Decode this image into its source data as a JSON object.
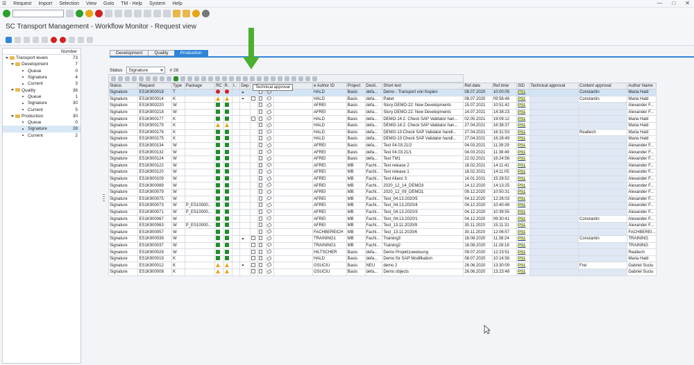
{
  "menu": [
    "Request",
    "Import",
    "Selection",
    "View",
    "Goto",
    "TM - Help",
    "System",
    "Help"
  ],
  "window_title": "SC Transport Management - Workflow Monitor - Request view",
  "tree": {
    "header_number": "Number",
    "rows": [
      {
        "label": "Transport levels",
        "num": "73",
        "level": 0,
        "type": "folder"
      },
      {
        "label": "Development",
        "num": "7",
        "level": 1,
        "type": "folder"
      },
      {
        "label": "Queue",
        "num": "0",
        "level": 2,
        "type": "item"
      },
      {
        "label": "Signature",
        "num": "4",
        "level": 2,
        "type": "item"
      },
      {
        "label": "Current",
        "num": "3",
        "level": 2,
        "type": "item"
      },
      {
        "label": "Quality",
        "num": "36",
        "level": 1,
        "type": "folder"
      },
      {
        "label": "Queue",
        "num": "1",
        "level": 2,
        "type": "item"
      },
      {
        "label": "Signature",
        "num": "30",
        "level": 2,
        "type": "item"
      },
      {
        "label": "Current",
        "num": "5",
        "level": 2,
        "type": "item"
      },
      {
        "label": "Production",
        "num": "30",
        "level": 1,
        "type": "folder"
      },
      {
        "label": "Queue",
        "num": "0",
        "level": 2,
        "type": "item"
      },
      {
        "label": "Signature",
        "num": "28",
        "level": 2,
        "type": "item",
        "selected": true
      },
      {
        "label": "Current",
        "num": "2",
        "level": 2,
        "type": "item"
      }
    ]
  },
  "tabs": [
    "Development",
    "Quality",
    "Production"
  ],
  "active_tab": "Production",
  "status": {
    "label": "Status",
    "value": "Signature",
    "count": "# 28"
  },
  "tooltip": "Technical approval",
  "columns": [
    "Status",
    "Request",
    "Type",
    "Package",
    "RC",
    "R..",
    "I..",
    "Dep",
    "",
    "",
    "",
    "",
    "e Author ID",
    "Project",
    "Desti..",
    "Short text",
    "Ref.date",
    "Ref.time",
    "SID",
    "Technical approval",
    "Content approval",
    "Author Name"
  ],
  "rows": [
    {
      "status": "Signature",
      "request": "ES1K900018",
      "type": "T",
      "pkg": "",
      "rc": "red",
      "dep": "lnk",
      "chk": false,
      "author": "HALD",
      "project": "Basis",
      "dest": "defa...",
      "text": "Demo - Transport von Kopien",
      "date": "08.07.2020",
      "time": "10:00:05",
      "sid": "PS1",
      "tech": "",
      "content": "Constantin",
      "name": "Maria Hald",
      "sel": true
    },
    {
      "status": "Signature",
      "request": "ES1K900014",
      "type": "K",
      "pkg": "",
      "rc": "tri",
      "dep": "lnk",
      "chk": true,
      "author": "HALD",
      "project": "Basis",
      "dest": "defa...",
      "text": "Paket",
      "date": "08.07.2020",
      "time": "09:56:46",
      "sid": "PS1",
      "tech": "",
      "content": "Constantin",
      "name": "Maria Hald"
    },
    {
      "status": "Signature",
      "request": "ES1K900220",
      "type": "W",
      "pkg": "",
      "rc": "green",
      "dep": "",
      "chk": false,
      "author": "AFREI",
      "project": "Basis",
      "dest": "defa...",
      "text": "Story DEMO-22: New Developments",
      "date": "15.07.2021",
      "time": "10:51:42",
      "sid": "PS1",
      "tech": "",
      "content": "",
      "name": "Alexander F..."
    },
    {
      "status": "Signature",
      "request": "ES1K900218",
      "type": "W",
      "pkg": "",
      "rc": "green",
      "dep": "",
      "chk": false,
      "author": "AFREI",
      "project": "Basis",
      "dest": "defa...",
      "text": "Story DEMO-22: New Developments",
      "date": "14.07.2021",
      "time": "14:38:23",
      "sid": "PS1",
      "tech": "",
      "content": "",
      "name": "Alexander F..."
    },
    {
      "status": "Signature",
      "request": "ES1K900177",
      "type": "K",
      "pkg": "",
      "rc": "green",
      "dep": "",
      "chk": true,
      "author": "HALD",
      "project": "Basis",
      "dest": "defa...",
      "text": "DEMO-14:2. Check SAP Validator han...",
      "date": "02.05.2021",
      "time": "19:09:12",
      "sid": "PS1",
      "tech": "",
      "content": "",
      "name": "Maria Hald"
    },
    {
      "status": "Signature",
      "request": "ES1K900179",
      "type": "K",
      "pkg": "",
      "rc": "tri",
      "dep": "",
      "chk": false,
      "author": "HALD",
      "project": "Basis",
      "dest": "defa...",
      "text": "DEMO-14:2. Check SAP Validator han...",
      "date": "27.04.2021",
      "time": "16:38:37",
      "sid": "PS1",
      "tech": "",
      "content": "",
      "name": "Maria Hald"
    },
    {
      "status": "Signature",
      "request": "ES1K900176",
      "type": "K",
      "pkg": "",
      "rc": "green",
      "dep": "",
      "chk": false,
      "author": "HALD",
      "project": "Basis",
      "dest": "defa...",
      "text": "DEMO-13:Check SAP Validator handl...",
      "date": "27.04.2021",
      "time": "16:31:53",
      "sid": "PS1",
      "tech": "",
      "content": "Realtech",
      "name": "Maria Hald"
    },
    {
      "status": "Signature",
      "request": "ES1K900175",
      "type": "K",
      "pkg": "",
      "rc": "green",
      "dep": "",
      "chk": false,
      "author": "HALD",
      "project": "Basis",
      "dest": "defa...",
      "text": "DEMO-13:Check SAP Validator handl...",
      "date": "27.04.2021",
      "time": "16:28:49",
      "sid": "PS1",
      "tech": "",
      "content": "",
      "name": "Maria Hald"
    },
    {
      "status": "Signature",
      "request": "ES1K900134",
      "type": "W",
      "pkg": "",
      "rc": "green",
      "dep": "",
      "chk": false,
      "author": "AFREI",
      "project": "Basis",
      "dest": "defa...",
      "text": "Test 04.03.21/2",
      "date": "04.03.2021",
      "time": "11:39:29",
      "sid": "PS1",
      "tech": "",
      "content": "",
      "name": "Alexander F..."
    },
    {
      "status": "Signature",
      "request": "ES1K900132",
      "type": "W",
      "pkg": "",
      "rc": "green",
      "dep": "",
      "chk": false,
      "author": "AFREI",
      "project": "Basis",
      "dest": "defa...",
      "text": "Test 04.03.21/1",
      "date": "04.03.2021",
      "time": "11:38:49",
      "sid": "PS1",
      "tech": "",
      "content": "",
      "name": "Alexander F..."
    },
    {
      "status": "Signature",
      "request": "ES1K900124",
      "type": "W",
      "pkg": "",
      "rc": "green",
      "dep": "",
      "chk": false,
      "author": "AFREI",
      "project": "Basis",
      "dest": "defa...",
      "text": "Test TM1",
      "date": "22.02.2021",
      "time": "16:24:56",
      "sid": "PS1",
      "tech": "",
      "content": "",
      "name": "Alexander F..."
    },
    {
      "status": "Signature",
      "request": "ES1K900122",
      "type": "W",
      "pkg": "",
      "rc": "green",
      "dep": "",
      "chk": false,
      "author": "AFREI",
      "project": "MB",
      "dest": "Fachl...",
      "text": "Test release 2",
      "date": "18.02.2021",
      "time": "14:11:41",
      "sid": "PS1",
      "tech": "",
      "content": "",
      "name": "Alexander F..."
    },
    {
      "status": "Signature",
      "request": "ES1K900120",
      "type": "W",
      "pkg": "",
      "rc": "green",
      "dep": "",
      "chk": false,
      "author": "AFREI",
      "project": "MB",
      "dest": "Fachl...",
      "text": "Test release 1",
      "date": "18.02.2021",
      "time": "14:11:05",
      "sid": "PS1",
      "tech": "",
      "content": "",
      "name": "Alexander F..."
    },
    {
      "status": "Signature",
      "request": "ES1K900109",
      "type": "W",
      "pkg": "",
      "rc": "green",
      "dep": "",
      "chk": false,
      "author": "AFREI",
      "project": "MB",
      "dest": "Fachl...",
      "text": "Test Allanz 3",
      "date": "14.01.2021",
      "time": "15:28:52",
      "sid": "PS1",
      "tech": "",
      "content": "",
      "name": "Alexander F..."
    },
    {
      "status": "Signature",
      "request": "ES1K900089",
      "type": "W",
      "pkg": "",
      "rc": "green",
      "dep": "",
      "chk": false,
      "author": "AFREI",
      "project": "MB",
      "dest": "Fachl...",
      "text": "2020_12_14_DEMO3",
      "date": "14.12.2020",
      "time": "14:13:25",
      "sid": "PS1",
      "tech": "",
      "content": "",
      "name": "Alexander F..."
    },
    {
      "status": "Signature",
      "request": "ES1K900079",
      "type": "W",
      "pkg": "",
      "rc": "green",
      "dep": "",
      "chk": false,
      "author": "AFREI",
      "project": "MB",
      "dest": "Fachl...",
      "text": "2020_12_09_DEMO1",
      "date": "09.12.2020",
      "time": "10:50:31",
      "sid": "PS1",
      "tech": "",
      "content": "",
      "name": "Alexander F..."
    },
    {
      "status": "Signature",
      "request": "ES1K900075",
      "type": "W",
      "pkg": "",
      "rc": "green",
      "dep": "",
      "chk": false,
      "author": "AFREI",
      "project": "MB",
      "dest": "Fachl...",
      "text": "Test_04.13.2020/5",
      "date": "04.12.2020",
      "time": "12:26:03",
      "sid": "PS1",
      "tech": "",
      "content": "",
      "name": "Alexander F..."
    },
    {
      "status": "Signature",
      "request": "ES1K900073",
      "type": "W",
      "pkg": "P_ES10000...",
      "rc": "green",
      "dep": "",
      "chk": false,
      "author": "AFREI",
      "project": "MB",
      "dest": "Fachl...",
      "text": "Test_04.13.2020/4",
      "date": "04.12.2020",
      "time": "10:40:48",
      "sid": "PS1",
      "tech": "",
      "content": "",
      "name": "Alexander F..."
    },
    {
      "status": "Signature",
      "request": "ES1K900071",
      "type": "W",
      "pkg": "P_ES10000...",
      "rc": "green",
      "dep": "",
      "chk": false,
      "author": "AFREI",
      "project": "MB",
      "dest": "Fachl...",
      "text": "Test_04.13.2020/3",
      "date": "04.12.2020",
      "time": "10:39:55",
      "sid": "PS1",
      "tech": "",
      "content": "",
      "name": "Alexander F..."
    },
    {
      "status": "Signature",
      "request": "ES1K900067",
      "type": "W",
      "pkg": "",
      "rc": "green",
      "dep": "",
      "chk": false,
      "author": "AFREI",
      "project": "MB",
      "dest": "Fachl...",
      "text": "Test_04.13.2020/1",
      "date": "04.12.2020",
      "time": "09:30:41",
      "sid": "PS1",
      "tech": "",
      "content": "Constantin",
      "name": "Alexander F..."
    },
    {
      "status": "Signature",
      "request": "ES1K900063",
      "type": "W",
      "pkg": "P_ES10000...",
      "rc": "green",
      "dep": "",
      "chk": false,
      "author": "AFREI",
      "project": "MB",
      "dest": "Fachl...",
      "text": "Test_13.11.2020/9",
      "date": "30.11.2020",
      "time": "15:11:31",
      "sid": "PS1",
      "tech": "",
      "content": "",
      "name": "Alexander F..."
    },
    {
      "status": "Signature",
      "request": "ES1K900057",
      "type": "W",
      "pkg": "",
      "rc": "green",
      "dep": "",
      "chk": false,
      "author": "FACHBEREICH",
      "project": "MB",
      "dest": "Fachl...",
      "text": "Test_13.11.2020/6",
      "date": "30.11.2020",
      "time": "12:06:57",
      "sid": "PS1",
      "tech": "",
      "content": "",
      "name": "FACHBEREI..."
    },
    {
      "status": "Signature",
      "request": "ES1K900039",
      "type": "W",
      "pkg": "",
      "rc": "green",
      "dep": "lnk",
      "chk": true,
      "author": "TRAINING1",
      "project": "MB",
      "dest": "Fachl...",
      "text": "Training3",
      "date": "18.08.2020",
      "time": "11:38:24",
      "sid": "PS1",
      "tech": "",
      "content": "Constantin",
      "name": "TRAINING"
    },
    {
      "status": "Signature",
      "request": "ES1K900037",
      "type": "W",
      "pkg": "",
      "rc": "green",
      "dep": "",
      "chk": true,
      "author": "TRAINING1",
      "project": "MB",
      "dest": "Fachl...",
      "text": "Training2",
      "date": "18.08.2020",
      "time": "11:28:18",
      "sid": "PS1",
      "tech": "",
      "content": "",
      "name": "TRAINING"
    },
    {
      "status": "Signature",
      "request": "ES1K900029",
      "type": "W",
      "pkg": "",
      "rc": "green",
      "dep": "",
      "chk": true,
      "author": "HILTSCHER",
      "project": "Basis",
      "dest": "defa...",
      "text": "Demo Projektzuweisung",
      "date": "09.07.2020",
      "time": "12:23:51",
      "sid": "PS1",
      "tech": "",
      "content": "",
      "name": "Realtech"
    },
    {
      "status": "Signature",
      "request": "ES1K900019",
      "type": "K",
      "pkg": "",
      "rc": "green",
      "dep": "",
      "chk": true,
      "author": "HALD",
      "project": "Basis",
      "dest": "defa...",
      "text": "Demo für SAP Modifkation",
      "date": "08.07.2020",
      "time": "10:14:56",
      "sid": "PS1",
      "tech": "",
      "content": "",
      "name": "Maria Hald"
    },
    {
      "status": "Signature",
      "request": "ES1K900012",
      "type": "K",
      "pkg": "",
      "rc": "tri",
      "dep": "lnk",
      "chk": true,
      "author": "GSUCIU",
      "project": "Basis",
      "dest": "NEU",
      "text": "demo 2",
      "date": "26.06.2020",
      "time": "13:30:09",
      "sid": "PS1",
      "tech": "",
      "content": "Frei",
      "name": "Gabriel Suciu"
    },
    {
      "status": "Signature",
      "request": "ES1K900008",
      "type": "K",
      "pkg": "",
      "rc": "tri",
      "dep": "",
      "chk": true,
      "author": "GSUCIU",
      "project": "Basis",
      "dest": "defa...",
      "text": "Demo objects",
      "date": "26.06.2020",
      "time": "13:23:48",
      "sid": "PS1",
      "tech": "",
      "content": "",
      "name": "Gabriel Suciu"
    }
  ],
  "colors": {
    "accent": "#2f85d8",
    "highlight_arrow": "#4caf2e",
    "selection": "#d3e4f5"
  }
}
